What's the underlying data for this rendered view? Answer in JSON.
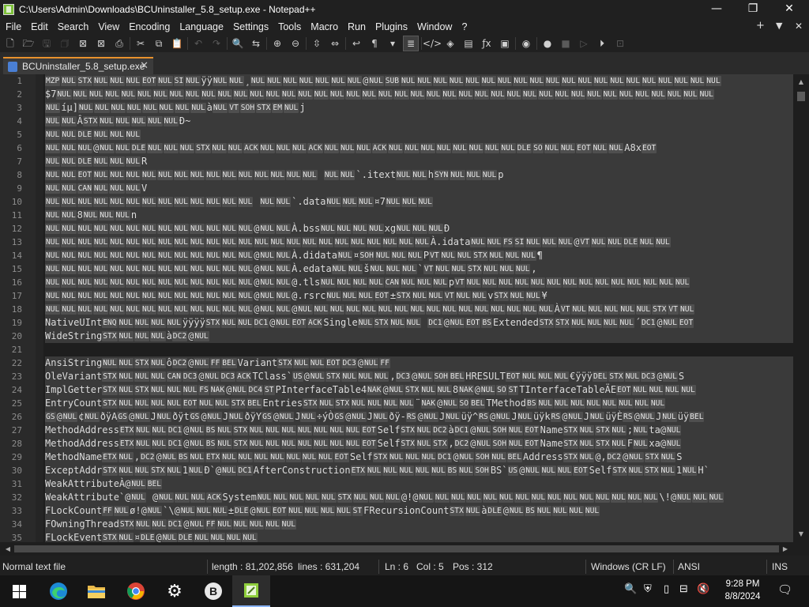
{
  "window": {
    "title": "C:\\Users\\Admin\\Downloads\\BCUninstaller_5.8_setup.exe - Notepad++",
    "minimize": "—",
    "maximize": "❐",
    "close": "✕"
  },
  "menu": {
    "items": [
      "File",
      "Edit",
      "Search",
      "View",
      "Encoding",
      "Language",
      "Settings",
      "Tools",
      "Macro",
      "Run",
      "Plugins",
      "Window",
      "?"
    ],
    "plus": "+",
    "dropdown": "▼",
    "close": "✕"
  },
  "toolbar": {
    "buttons": [
      {
        "name": "new-file-icon",
        "glyph": "🗋"
      },
      {
        "name": "open-file-icon",
        "glyph": "🗁"
      },
      {
        "name": "save-icon",
        "glyph": "🖫",
        "dim": true
      },
      {
        "name": "save-all-icon",
        "glyph": "🗇",
        "dim": true
      },
      {
        "name": "close-icon",
        "glyph": "⊠"
      },
      {
        "name": "close-all-icon",
        "glyph": "⊠"
      },
      {
        "name": "print-icon",
        "glyph": "⎙"
      },
      {
        "sep": true
      },
      {
        "name": "cut-icon",
        "glyph": "✂"
      },
      {
        "name": "copy-icon",
        "glyph": "⧉"
      },
      {
        "name": "paste-icon",
        "glyph": "📋",
        "dim": true
      },
      {
        "sep": true
      },
      {
        "name": "undo-icon",
        "glyph": "↶",
        "dim": true
      },
      {
        "name": "redo-icon",
        "glyph": "↷",
        "dim": true
      },
      {
        "sep": true
      },
      {
        "name": "find-icon",
        "glyph": "🔍"
      },
      {
        "name": "replace-icon",
        "glyph": "⇆"
      },
      {
        "sep": true
      },
      {
        "name": "zoom-in-icon",
        "glyph": "⊕"
      },
      {
        "name": "zoom-out-icon",
        "glyph": "⊖"
      },
      {
        "sep": true
      },
      {
        "name": "sync-vertical-icon",
        "glyph": "⇳"
      },
      {
        "name": "sync-horizontal-icon",
        "glyph": "⇔"
      },
      {
        "sep": true
      },
      {
        "name": "word-wrap-icon",
        "glyph": "↩"
      },
      {
        "name": "show-all-chars-icon",
        "glyph": "¶"
      },
      {
        "name": "indent-guide-icon",
        "glyph": "▾"
      },
      {
        "name": "indent-guide-active-icon",
        "glyph": "≣",
        "on": true
      },
      {
        "sep": true
      },
      {
        "name": "language-icon",
        "glyph": "</>"
      },
      {
        "name": "document-map-icon",
        "glyph": "◈"
      },
      {
        "name": "document-list-icon",
        "glyph": "▤"
      },
      {
        "name": "function-list-icon",
        "glyph": "ƒx"
      },
      {
        "name": "folder-workspace-icon",
        "glyph": "▣"
      },
      {
        "sep": true
      },
      {
        "name": "monitoring-icon",
        "glyph": "◉"
      },
      {
        "sep": true
      },
      {
        "name": "record-macro-icon",
        "glyph": "●"
      },
      {
        "name": "stop-recording-icon",
        "glyph": "■",
        "dim": true
      },
      {
        "name": "play-macro-icon",
        "glyph": "▷",
        "dim": true
      },
      {
        "name": "run-macro-multiple-icon",
        "glyph": "⏵"
      },
      {
        "name": "save-macro-icon",
        "glyph": "⊡",
        "dim": true
      }
    ]
  },
  "tabs": [
    {
      "label": "BCUninstaller_5.8_setup.exe",
      "close": "✕"
    }
  ],
  "editor": {
    "lines": [
      {
        "n": "1",
        "t": "MZP|NUL|STX|NUL|NUL|NUL|EOT|NUL|SI|NUL|ÿÿ|NUL|NUL|¸|NUL|NUL|NUL|NUL|NUL|NUL|NUL|@|NUL|SUB|NUL|NUL|NUL|NUL|NUL|NUL|NUL|NUL|NUL|NUL|NUL|NUL|NUL|NUL|NUL|NUL|NUL|NUL|NUL|NUL"
      },
      {
        "n": "2",
        "t": "$7|NUL|NUL|NUL|NUL|NUL|NUL|NUL|NUL|NUL|NUL|NUL|NUL|NUL|NUL|NUL|NUL|NUL|NUL|NUL|NUL|NUL|NUL|NUL|NUL|NUL|NUL|NUL|NUL|NUL|NUL|NUL|NUL|NUL|NUL|NUL|NUL|NUL|NUL|NUL|NUL|NUL"
      },
      {
        "n": "3",
        "t": "NUL|íµ]|NUL|NUL|NUL|NUL|NUL|NUL|NUL|NUL|à|NUL|VT|SOH|STX|EM|NUL|j"
      },
      {
        "n": "4",
        "t": "NUL|NUL|Â|STX|NUL|NUL|NUL|NUL|NUL|Ð~"
      },
      {
        "n": "5",
        "t": "NUL|NUL|DLE|NUL|NUL|NUL"
      },
      {
        "n": "6",
        "t": "NUL|NUL|NUL|@|NUL|NUL|DLE|NUL|NUL|NUL|STX|NUL|NUL|ACK|NUL|NUL|NUL|ACK|NUL|NUL|NUL|ACK|NUL|NUL|NUL|NUL|NUL|NUL|NUL|NUL|DLE|SO|NUL|NUL|EOT|NUL|NUL|A8x|EOT"
      },
      {
        "n": "7",
        "t": "NUL|NUL|DLE|NUL|NUL|NUL|R"
      },
      {
        "n": "8",
        "t": "NUL|NUL|EOT|NUL|NUL|NUL|NUL|NUL|NUL|NUL|NUL|NUL|NUL|NUL|NUL|NUL|NUL| |NUL|NUL|`.itext|NUL|NUL|h|SYN|NUL|NUL|NUL|p"
      },
      {
        "n": "9",
        "t": "NUL|NUL|CAN|NUL|NUL|NUL|V"
      },
      {
        "n": "10",
        "t": "NUL|NUL|NUL|NUL|NUL|NUL|NUL|NUL|NUL|NUL|NUL|NUL|NUL| |NUL|NUL|`.data|NUL|NUL|NUL|¤7|NUL|NUL|NUL"
      },
      {
        "n": "11",
        "t": "NUL|NUL|8|NUL|NUL|NUL|n"
      },
      {
        "n": "12",
        "t": "NUL|NUL|NUL|NUL|NUL|NUL|NUL|NUL|NUL|NUL|NUL|NUL|NUL|@|NUL|NUL|À.bss|NUL|NUL|NUL|NUL|xg|NUL|NUL|NUL|Ð"
      },
      {
        "n": "13",
        "t": "NUL|NUL|NUL|NUL|NUL|NUL|NUL|NUL|NUL|NUL|NUL|NUL|NUL|NUL|NUL|NUL|NUL|NUL|NUL|NUL|NUL|NUL|NUL|NUL|À.idata|NUL|NUL|FS|SI|NUL|NUL|NUL|@|VT|NUL|NUL|DLE|NUL|NUL"
      },
      {
        "n": "14",
        "t": "NUL|NUL|NUL|NUL|NUL|NUL|NUL|NUL|NUL|NUL|NUL|NUL|NUL|@|NUL|NUL|À.didata|NUL|¤|SOH|NUL|NUL|NUL|P|VT|NUL|NUL|STX|NUL|NUL|NUL|¶"
      },
      {
        "n": "15",
        "t": "NUL|NUL|NUL|NUL|NUL|NUL|NUL|NUL|NUL|NUL|NUL|NUL|NUL|@|NUL|NUL|À.edata|NUL|NUL|š|NUL|NUL|NUL|`|VT|NUL|NUL|STX|NUL|NUL|NUL|,"
      },
      {
        "n": "16",
        "t": "NUL|NUL|NUL|NUL|NUL|NUL|NUL|NUL|NUL|NUL|NUL|NUL|NUL|@|NUL|NUL|@.tls|NUL|NUL|NUL|NUL|CAN|NUL|NUL|NUL|p|VT|NUL|NUL|NUL|NUL|NUL|NUL|NUL|NUL|NUL|NUL|NUL|NUL|NUL|NUL"
      },
      {
        "n": "17",
        "t": "NUL|NUL|NUL|NUL|NUL|NUL|NUL|NUL|NUL|NUL|NUL|NUL|NUL|@|NUL|NUL|@.rsrc|NUL|NUL|NUL|EOT|±|STX|NUL|NUL|VT|NUL|NUL|v|STX|NUL|NUL|¥"
      },
      {
        "n": "18",
        "t": "NUL|NUL|NUL|NUL|NUL|NUL|NUL|NUL|NUL|NUL|NUL|NUL|NUL|@|NUL|NUL|@|NUL|NUL|NUL|NUL|NUL|NUL|NUL|NUL|NUL|NUL|NUL|NUL|NUL|NUL|NUL|NUL|À|VT|NUL|NUL|NUL|NUL|NUL|STX|VT|NUL"
      },
      {
        "n": "19",
        "t": "NativeUInt|ENQ|NUL|NUL|NUL|NUL|ÿÿÿÿ|STX|NUL|NUL|DC1|@|NUL|EOT|ACK|Single|NUL|STX|NUL|NUL| |DC1|@|NUL|EOT|BS|Extended|STX|STX|NUL|NUL|NUL|NUL|´|DC1|@|NUL|EOT"
      },
      {
        "n": "20",
        "t": "WideString|STX|NUL|NUL|NUL|à|DC2|@|NUL"
      },
      {
        "n": "21",
        "t": ""
      },
      {
        "n": "22",
        "t": "AnsiString|NUL|NUL|STX|NUL|ô|DC2|@|NUL|FF|BEL|Variant|STX|NUL|NUL|EOT|DC3|@|NUL|FF"
      },
      {
        "n": "23",
        "t": "OleVariant|STX|NUL|NUL|NUL|CAN|DC3|@|NUL|DC3|ACK|TClass`|US|@|NUL|STX|NUL|NUL|NUL|,|DC3|@|NUL|SOH|BEL|HRESULT|EOT|NUL|NUL|NUL|€ÿÿÿ|DEL|STX|NUL|DC3|@|NUL|S"
      },
      {
        "n": "24",
        "t": "ImplGetter|STX|NUL|STX|NUL|NUL|NUL|FS|NAK|@|NUL|DC4|ST|PInterfaceTable4|NAK|@|NUL|STX|NUL|NUL|8|NAK|@|NUL|SO|ST|TInterfaceTableÄE|EOT|NUL|NUL|NUL|NUL"
      },
      {
        "n": "25",
        "t": "EntryCount|STX|NUL|NUL|NUL|NUL|EOT|NUL|NUL|STX|BEL|Entries|STX|NUL|STX|NUL|NUL|NUL|NUL|¨|NAK|@|NUL|SO|BEL|TMethod|BS|NUL|NUL|NUL|NUL|NUL|NUL|NUL|NUL"
      },
      {
        "n": "26",
        "t": "GS|@|NUL|¢|NUL|ðÿA|GS|@|NUL|J|NUL|ðÿt|GS|@|NUL|J|NUL|ðÿY|GS|@|NUL|J|NUL|÷ýÒ|GS|@|NUL|J|NUL|ðÿ-|RS|@|NUL|J|NUL|üÿ^|RS|@|NUL|J|NUL|üÿk|RS|@|NUL|J|NUL|üÿÈ|RS|@|NUL|J|NUL|üÿ|BEL"
      },
      {
        "n": "27",
        "t": "MethodAddress|ETX|NUL|NUL|DC1|@|NUL|BS|NUL|STX|NUL|NUL|NUL|NUL|NUL|NUL|NUL|EOT|Self|STX|NUL|DC2|à|DC1|@|NUL|SOH|NUL|EOT|Name|STX|NUL|STX|NUL|;|NUL|ta|@|NUL"
      },
      {
        "n": "28",
        "t": "MethodAddress|ETX|NUL|NUL|DC1|@|NUL|BS|NUL|STX|NUL|NUL|NUL|NUL|NUL|NUL|NUL|EOT|Self|STX|NUL|STX|,|DC2|@|NUL|SOH|NUL|EOT|Name|STX|NUL|STX|NUL|F|NUL|xa|@|NUL"
      },
      {
        "n": "29",
        "t": "MethodName|ETX|NUL|,|DC2|@|NUL|BS|NUL|ETX|NUL|NUL|NUL|NUL|NUL|NUL|NUL|EOT|Self|STX|NUL|NUL|NUL|DC1|@|NUL|SOH|NUL|BEL|Address|STX|NUL|@,|DC2|@|NUL|STX|NUL|S"
      },
      {
        "n": "30",
        "t": "ExceptAddr|STX|NUL|NUL|STX|NUL|1|NUL|Ð`|@|NUL|DC1|AfterConstruction|ETX|NUL|NUL|NUL|NUL|NUL|BS|NUL|SOH|BS`|US|@|NUL|NUL|NUL|EOT|Self|STX|NUL|STX|NUL|1|NUL|H`|"
      },
      {
        "n": "31",
        "t": "WeakAttributeÀ|@|NUL|BEL"
      },
      {
        "n": "32",
        "t": "WeakAttribute`|@|NUL| |@|NUL|NUL|NUL|ACK|System|NUL|NUL|NUL|NUL|NUL|STX|NUL|NUL|NUL|@!|@|NUL|NUL|NUL|NUL|NUL|NUL|NUL|NUL|NUL|NUL|NUL|NUL|NUL|NUL|NUL|\\!|@|NUL|NUL|NUL"
      },
      {
        "n": "33",
        "t": "FLockCount|FF|NUL|ø!|@|NUL|`\\|@|NUL|NUL|NUL|±|DLE|@|NUL|EOT|NUL|NUL|NUL|NUL|ST|FRecursionCount|STX|NUL|à|DLE|@|NUL|BS|NUL|NUL|NUL|NUL"
      },
      {
        "n": "34",
        "t": "FOwningThread|STX|NUL|NUL|DC1|@|NUL|FF|NUL|NUL|NUL|NUL|NUL"
      },
      {
        "n": "35",
        "t": "FLockEvent|STX|NUL|¤|DLE|@|NUL|DLE|NUL|NUL|NUL|NUL"
      }
    ]
  },
  "scroll": {
    "up": "▲",
    "down": "▼",
    "left": "◀",
    "right": "▶"
  },
  "status": {
    "type": "Normal text file",
    "length": "length : 81,202,856",
    "lines": "lines : 631,204",
    "ln": "Ln : 6",
    "col": "Col : 5",
    "pos": "Pos : 312",
    "eol": "Windows (CR LF)",
    "encoding": "ANSI",
    "mode": "INS"
  },
  "taskbar": {
    "time": "9:28 PM",
    "date": "8/8/2024"
  },
  "colors": {
    "background": "#1e1e1e",
    "chrome": "#202020",
    "selection": "#3a3a3a",
    "control_char_bg": "#4f4f4f",
    "tab_accent": "#e8912d"
  }
}
